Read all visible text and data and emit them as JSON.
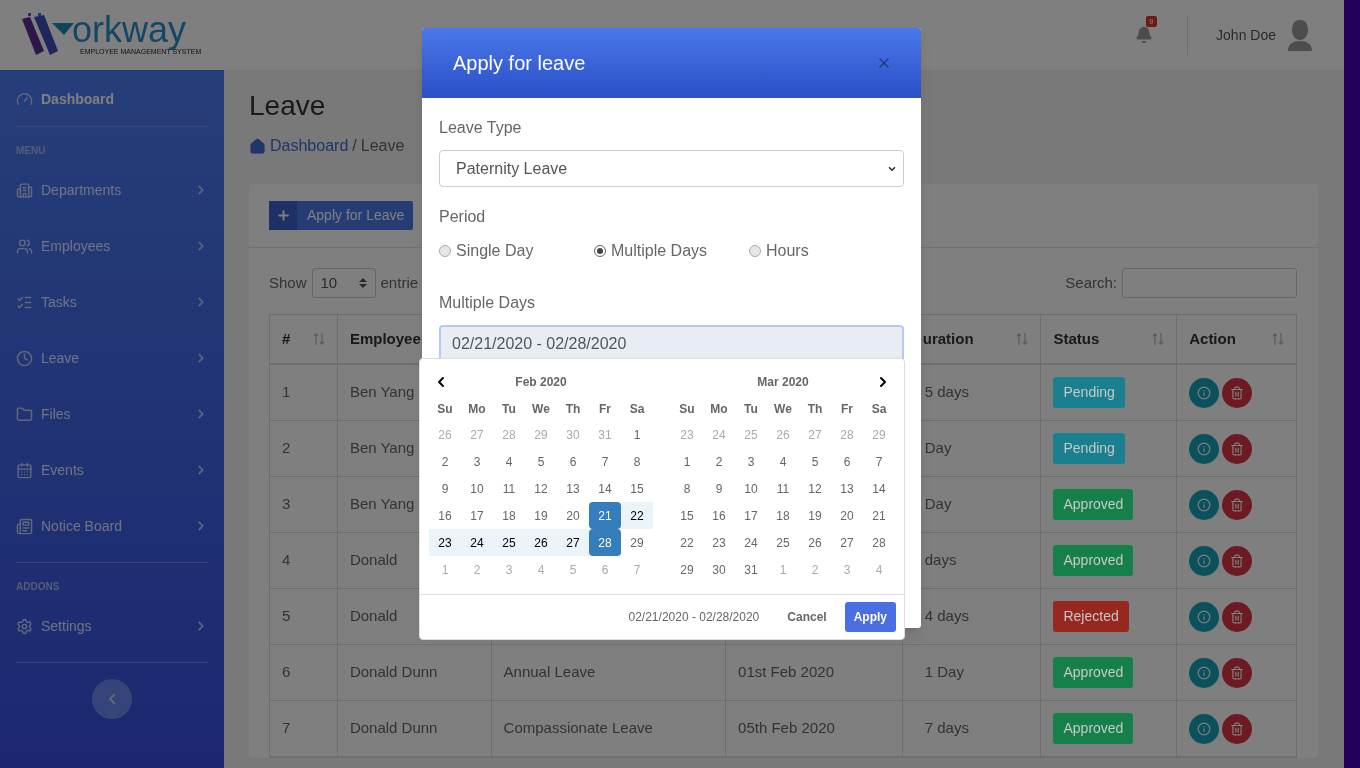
{
  "header": {
    "logo": {
      "wordmark": "orkway",
      "tagline": "EMPLOYEE MANAGEMENT SYSTEM"
    },
    "notifications": "9",
    "user": "John Doe"
  },
  "sidebar": {
    "sections": [
      {
        "items": [
          {
            "label": "Dashboard",
            "selected": true,
            "submenu": false
          }
        ]
      },
      {
        "heading": "MENU",
        "items": [
          {
            "label": "Departments",
            "selected": false,
            "submenu": true
          },
          {
            "label": "Employees",
            "selected": false,
            "submenu": true
          },
          {
            "label": "Tasks",
            "selected": false,
            "submenu": true
          },
          {
            "label": "Leave",
            "selected": false,
            "submenu": true
          },
          {
            "label": "Files",
            "selected": false,
            "submenu": true
          },
          {
            "label": "Events",
            "selected": false,
            "submenu": true
          },
          {
            "label": "Notice Board",
            "selected": false,
            "submenu": true
          }
        ]
      },
      {
        "heading": "ADDONS",
        "items": [
          {
            "label": "Settings",
            "selected": false,
            "submenu": true
          }
        ]
      }
    ]
  },
  "page": {
    "title": "Leave",
    "breadcrumb": {
      "link": "Dashboard",
      "separator": "/",
      "current": "Leave"
    }
  },
  "card": {
    "button": "Apply for Leave",
    "length": {
      "label": "Show",
      "value": "10",
      "suffix": "entrie"
    },
    "search": {
      "label": "Search:"
    },
    "table": {
      "columns": [
        {
          "label": "#",
          "sortable": true
        },
        {
          "label": "Employee"
        },
        {},
        {},
        {
          "label": "uration",
          "sortable": true
        },
        {
          "label": "Status",
          "sortable": true
        },
        {
          "label": "Action",
          "sortable": true
        }
      ],
      "rows": [
        {
          "no": "1",
          "employee": "Ben Yang",
          "duration": "5 days",
          "status": {
            "label": "Pending",
            "color": "#1a8090"
          }
        },
        {
          "no": "2",
          "employee": "Ben Yang",
          "duration": "Day",
          "status": {
            "label": "Pending",
            "color": "#1a8090"
          }
        },
        {
          "no": "3",
          "employee": "Ben Yang",
          "duration": "Day",
          "status": {
            "label": "Approved",
            "color": "#16804a"
          }
        },
        {
          "no": "4",
          "employee": "Donald",
          "duration": "days",
          "status": {
            "label": "Approved",
            "color": "#16804a"
          }
        },
        {
          "no": "5",
          "employee": "Donald",
          "duration": "4 days",
          "status": {
            "label": "Rejected",
            "color": "#962820"
          }
        },
        {
          "no": "6",
          "employee": "Donald Dunn",
          "type": "Annual Leave",
          "date": "01st Feb 2020",
          "duration": "1 Day",
          "status": {
            "label": "Approved",
            "color": "#16804a"
          }
        },
        {
          "no": "7",
          "employee": "Donald Dunn",
          "type": "Compassionate Leave",
          "date": "05th Feb 2020",
          "duration": "7 days",
          "status": {
            "label": "Approved",
            "color": "#16804a"
          }
        }
      ]
    }
  },
  "dialog": {
    "title": "Apply for leave",
    "leave_type": {
      "label": "Leave Type",
      "value": "Paternity Leave"
    },
    "period": {
      "label": "Period",
      "options": [
        {
          "label": "Single Day",
          "selected": false
        },
        {
          "label": "Multiple Days",
          "selected": true
        },
        {
          "label": "Hours",
          "selected": false
        }
      ]
    },
    "range": {
      "label": "Multiple Days",
      "value": "02/21/2020 - 02/28/2020"
    }
  },
  "datepicker": {
    "months": [
      {
        "title": "Feb 2020",
        "prev_arrow": true,
        "next_arrow": false,
        "weekdays": [
          "Su",
          "Mo",
          "Tu",
          "We",
          "Th",
          "Fr",
          "Sa"
        ],
        "weeks": [
          [
            {
              "label": "26",
              "outside": true,
              "in_range": false,
              "selected": false
            },
            {
              "label": "27",
              "outside": true,
              "in_range": false,
              "selected": false
            },
            {
              "label": "28",
              "outside": true,
              "in_range": false,
              "selected": false
            },
            {
              "label": "29",
              "outside": true,
              "in_range": false,
              "selected": false
            },
            {
              "label": "30",
              "outside": true,
              "in_range": false,
              "selected": false
            },
            {
              "label": "31",
              "outside": true,
              "in_range": false,
              "selected": false
            },
            {
              "label": "1",
              "outside": false,
              "in_range": false,
              "selected": false
            }
          ],
          [
            {
              "label": "2",
              "outside": false,
              "in_range": false,
              "selected": false
            },
            {
              "label": "3",
              "outside": false,
              "in_range": false,
              "selected": false
            },
            {
              "label": "4",
              "outside": false,
              "in_range": false,
              "selected": false
            },
            {
              "label": "5",
              "outside": false,
              "in_range": false,
              "selected": false
            },
            {
              "label": "6",
              "outside": false,
              "in_range": false,
              "selected": false
            },
            {
              "label": "7",
              "outside": false,
              "in_range": false,
              "selected": false
            },
            {
              "label": "8",
              "outside": false,
              "in_range": false,
              "selected": false
            }
          ],
          [
            {
              "label": "9",
              "outside": false,
              "in_range": false,
              "selected": false
            },
            {
              "label": "10",
              "outside": false,
              "in_range": false,
              "selected": false
            },
            {
              "label": "11",
              "outside": false,
              "in_range": false,
              "selected": false
            },
            {
              "label": "12",
              "outside": false,
              "in_range": false,
              "selected": false
            },
            {
              "label": "13",
              "outside": false,
              "in_range": false,
              "selected": false
            },
            {
              "label": "14",
              "outside": false,
              "in_range": false,
              "selected": false
            },
            {
              "label": "15",
              "outside": false,
              "in_range": false,
              "selected": false
            }
          ],
          [
            {
              "label": "16",
              "outside": false,
              "in_range": false,
              "selected": false
            },
            {
              "label": "17",
              "outside": false,
              "in_range": false,
              "selected": false
            },
            {
              "label": "18",
              "outside": false,
              "in_range": false,
              "selected": false
            },
            {
              "label": "19",
              "outside": false,
              "in_range": false,
              "selected": false
            },
            {
              "label": "20",
              "outside": false,
              "in_range": false,
              "selected": false
            },
            {
              "label": "21",
              "outside": false,
              "in_range": true,
              "selected": true
            },
            {
              "label": "22",
              "outside": false,
              "in_range": true,
              "selected": false
            }
          ],
          [
            {
              "label": "23",
              "outside": false,
              "in_range": true,
              "selected": false
            },
            {
              "label": "24",
              "outside": false,
              "in_range": true,
              "selected": false
            },
            {
              "label": "25",
              "outside": false,
              "in_range": true,
              "selected": false
            },
            {
              "label": "26",
              "outside": false,
              "in_range": true,
              "selected": false
            },
            {
              "label": "27",
              "outside": false,
              "in_range": true,
              "selected": false
            },
            {
              "label": "28",
              "outside": false,
              "in_range": true,
              "selected": true
            },
            {
              "label": "29",
              "outside": false,
              "in_range": false,
              "selected": false
            }
          ],
          [
            {
              "label": "1",
              "outside": true,
              "in_range": false,
              "selected": false
            },
            {
              "label": "2",
              "outside": true,
              "in_range": false,
              "selected": false
            },
            {
              "label": "3",
              "outside": true,
              "in_range": false,
              "selected": false
            },
            {
              "label": "4",
              "outside": true,
              "in_range": false,
              "selected": false
            },
            {
              "label": "5",
              "outside": true,
              "in_range": false,
              "selected": false
            },
            {
              "label": "6",
              "outside": true,
              "in_range": false,
              "selected": false
            },
            {
              "label": "7",
              "outside": true,
              "in_range": false,
              "selected": false
            }
          ]
        ]
      },
      {
        "title": "Mar 2020",
        "prev_arrow": false,
        "next_arrow": true,
        "weekdays": [
          "Su",
          "Mo",
          "Tu",
          "We",
          "Th",
          "Fr",
          "Sa"
        ],
        "weeks": [
          [
            {
              "label": "23",
              "outside": true,
              "in_range": false,
              "selected": false
            },
            {
              "label": "24",
              "outside": true,
              "in_range": false,
              "selected": false
            },
            {
              "label": "25",
              "outside": true,
              "in_range": false,
              "selected": false
            },
            {
              "label": "26",
              "outside": true,
              "in_range": false,
              "selected": false
            },
            {
              "label": "27",
              "outside": true,
              "in_range": false,
              "selected": false
            },
            {
              "label": "28",
              "outside": true,
              "in_range": false,
              "selected": false
            },
            {
              "label": "29",
              "outside": true,
              "in_range": false,
              "selected": false
            }
          ],
          [
            {
              "label": "1",
              "outside": false,
              "in_range": false,
              "selected": false
            },
            {
              "label": "2",
              "outside": false,
              "in_range": false,
              "selected": false
            },
            {
              "label": "3",
              "outside": false,
              "in_range": false,
              "selected": false
            },
            {
              "label": "4",
              "outside": false,
              "in_range": false,
              "selected": false
            },
            {
              "label": "5",
              "outside": false,
              "in_range": false,
              "selected": false
            },
            {
              "label": "6",
              "outside": false,
              "in_range": false,
              "selected": false
            },
            {
              "label": "7",
              "outside": false,
              "in_range": false,
              "selected": false
            }
          ],
          [
            {
              "label": "8",
              "outside": false,
              "in_range": false,
              "selected": false
            },
            {
              "label": "9",
              "outside": false,
              "in_range": false,
              "selected": false
            },
            {
              "label": "10",
              "outside": false,
              "in_range": false,
              "selected": false
            },
            {
              "label": "11",
              "outside": false,
              "in_range": false,
              "selected": false
            },
            {
              "label": "12",
              "outside": false,
              "in_range": false,
              "selected": false
            },
            {
              "label": "13",
              "outside": false,
              "in_range": false,
              "selected": false
            },
            {
              "label": "14",
              "outside": false,
              "in_range": false,
              "selected": false
            }
          ],
          [
            {
              "label": "15",
              "outside": false,
              "in_range": false,
              "selected": false
            },
            {
              "label": "16",
              "outside": false,
              "in_range": false,
              "selected": false
            },
            {
              "label": "17",
              "outside": false,
              "in_range": false,
              "selected": false
            },
            {
              "label": "18",
              "outside": false,
              "in_range": false,
              "selected": false
            },
            {
              "label": "19",
              "outside": false,
              "in_range": false,
              "selected": false
            },
            {
              "label": "20",
              "outside": false,
              "in_range": false,
              "selected": false
            },
            {
              "label": "21",
              "outside": false,
              "in_range": false,
              "selected": false
            }
          ],
          [
            {
              "label": "22",
              "outside": false,
              "in_range": false,
              "selected": false
            },
            {
              "label": "23",
              "outside": false,
              "in_range": false,
              "selected": false
            },
            {
              "label": "24",
              "outside": false,
              "in_range": false,
              "selected": false
            },
            {
              "label": "25",
              "outside": false,
              "in_range": false,
              "selected": false
            },
            {
              "label": "26",
              "outside": false,
              "in_range": false,
              "selected": false
            },
            {
              "label": "27",
              "outside": false,
              "in_range": false,
              "selected": false
            },
            {
              "label": "28",
              "outside": false,
              "in_range": false,
              "selected": false
            }
          ],
          [
            {
              "label": "29",
              "outside": false,
              "in_range": false,
              "selected": false
            },
            {
              "label": "30",
              "outside": false,
              "in_range": false,
              "selected": false
            },
            {
              "label": "31",
              "outside": false,
              "in_range": false,
              "selected": false
            },
            {
              "label": "1",
              "outside": true,
              "in_range": false,
              "selected": false
            },
            {
              "label": "2",
              "outside": true,
              "in_range": false,
              "selected": false
            },
            {
              "label": "3",
              "outside": true,
              "in_range": false,
              "selected": false
            },
            {
              "label": "4",
              "outside": true,
              "in_range": false,
              "selected": false
            }
          ]
        ]
      }
    ],
    "summary": "02/21/2020 - 02/28/2020",
    "buttons": {
      "cancel": "Cancel",
      "apply": "Apply"
    }
  }
}
